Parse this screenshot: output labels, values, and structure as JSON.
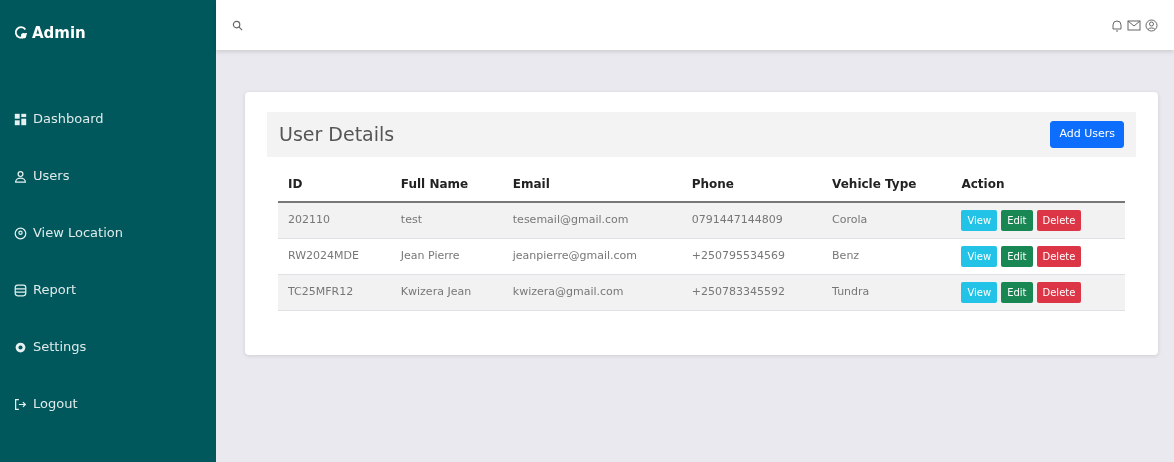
{
  "brand": "Admin",
  "sidebar": {
    "items": [
      {
        "label": "Dashboard",
        "kind": "dashboard"
      },
      {
        "label": "Users",
        "kind": "user"
      },
      {
        "label": "View Location",
        "kind": "location"
      },
      {
        "label": "Report",
        "kind": "report"
      },
      {
        "label": "Settings",
        "kind": "settings"
      },
      {
        "label": "Logout",
        "kind": "logout"
      }
    ]
  },
  "card": {
    "title": "User Details",
    "add_button": "Add Users"
  },
  "table": {
    "columns": [
      "ID",
      "Full Name",
      "Email",
      "Phone",
      "Vehicle Type",
      "Action"
    ],
    "rows": [
      {
        "cells": [
          "202110",
          "test",
          "tesemail@gmail.com",
          "0791447144809",
          "Corola"
        ],
        "actions": [
          {
            "label": "View",
            "kind": "view"
          },
          {
            "label": "Edit",
            "kind": "edit"
          },
          {
            "label": "Delete",
            "kind": "delete"
          }
        ]
      },
      {
        "cells": [
          "RW2024MDE",
          "Jean Pierre",
          "jeanpierre@gmail.com",
          "+250795534569",
          "Benz"
        ],
        "actions": [
          {
            "label": "View",
            "kind": "view"
          },
          {
            "label": "Edit",
            "kind": "edit"
          },
          {
            "label": "Delete",
            "kind": "delete"
          }
        ]
      },
      {
        "cells": [
          "TC25MFR12",
          "Kwizera Jean",
          "kwizera@gmail.com",
          "+250783345592",
          "Tundra"
        ],
        "actions": [
          {
            "label": "View",
            "kind": "view"
          },
          {
            "label": "Edit",
            "kind": "edit"
          },
          {
            "label": "Delete",
            "kind": "delete"
          }
        ]
      }
    ]
  }
}
